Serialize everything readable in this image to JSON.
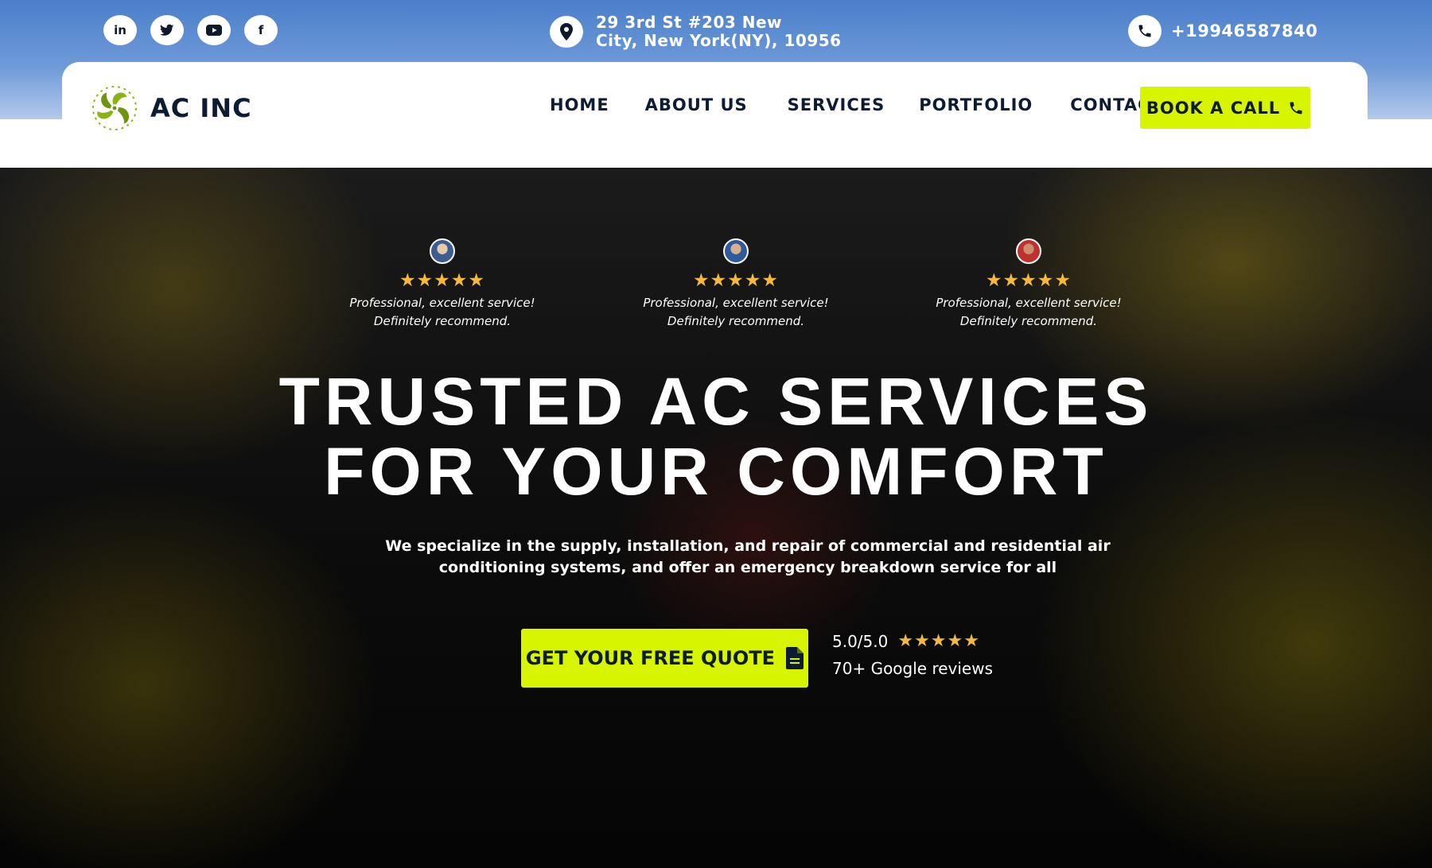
{
  "topbar": {
    "social": [
      {
        "label": "in",
        "icon": "linkedin-icon"
      },
      {
        "label": "t",
        "icon": "twitter-icon"
      },
      {
        "label": "▶",
        "icon": "youtube-icon"
      },
      {
        "label": "f",
        "icon": "facebook-icon"
      }
    ],
    "address_line1": "29 3rd St #203 New",
    "address_line2": "City, New York(NY), 10956",
    "phone": "+19946587840"
  },
  "nav": {
    "brand": "AC INC",
    "items": [
      "HOME",
      "ABOUT US",
      "SERVICES",
      "PORTFOLIO",
      "CONTACT"
    ],
    "cta": "BOOK A CALL"
  },
  "reviews": [
    {
      "stars": "★★★★★",
      "line1": "Professional, excellent service!",
      "line2": "Definitely recommend."
    },
    {
      "stars": "★★★★★",
      "line1": "Professional, excellent service!",
      "line2": "Definitely recommend."
    },
    {
      "stars": "★★★★★",
      "line1": "Professional, excellent service!",
      "line2": "Definitely recommend."
    }
  ],
  "hero": {
    "headline_line1": "TRUSTED AC SERVICES",
    "headline_line2": "FOR YOUR COMFORT",
    "subtext_line1": "We specialize in the supply, installation, and repair of commercial and residential air",
    "subtext_line2": "conditioning systems, and offer an emergency breakdown service for all",
    "cta": "GET YOUR FREE QUOTE",
    "rating_value": "5.0/5.0",
    "rating_stars": "★★★★★",
    "rating_count": "70+ Google reviews"
  },
  "colors": {
    "accent": "#d8f500",
    "navy": "#0d1b33",
    "star": "#f6b93b",
    "brand_green": "#8ab31a"
  }
}
